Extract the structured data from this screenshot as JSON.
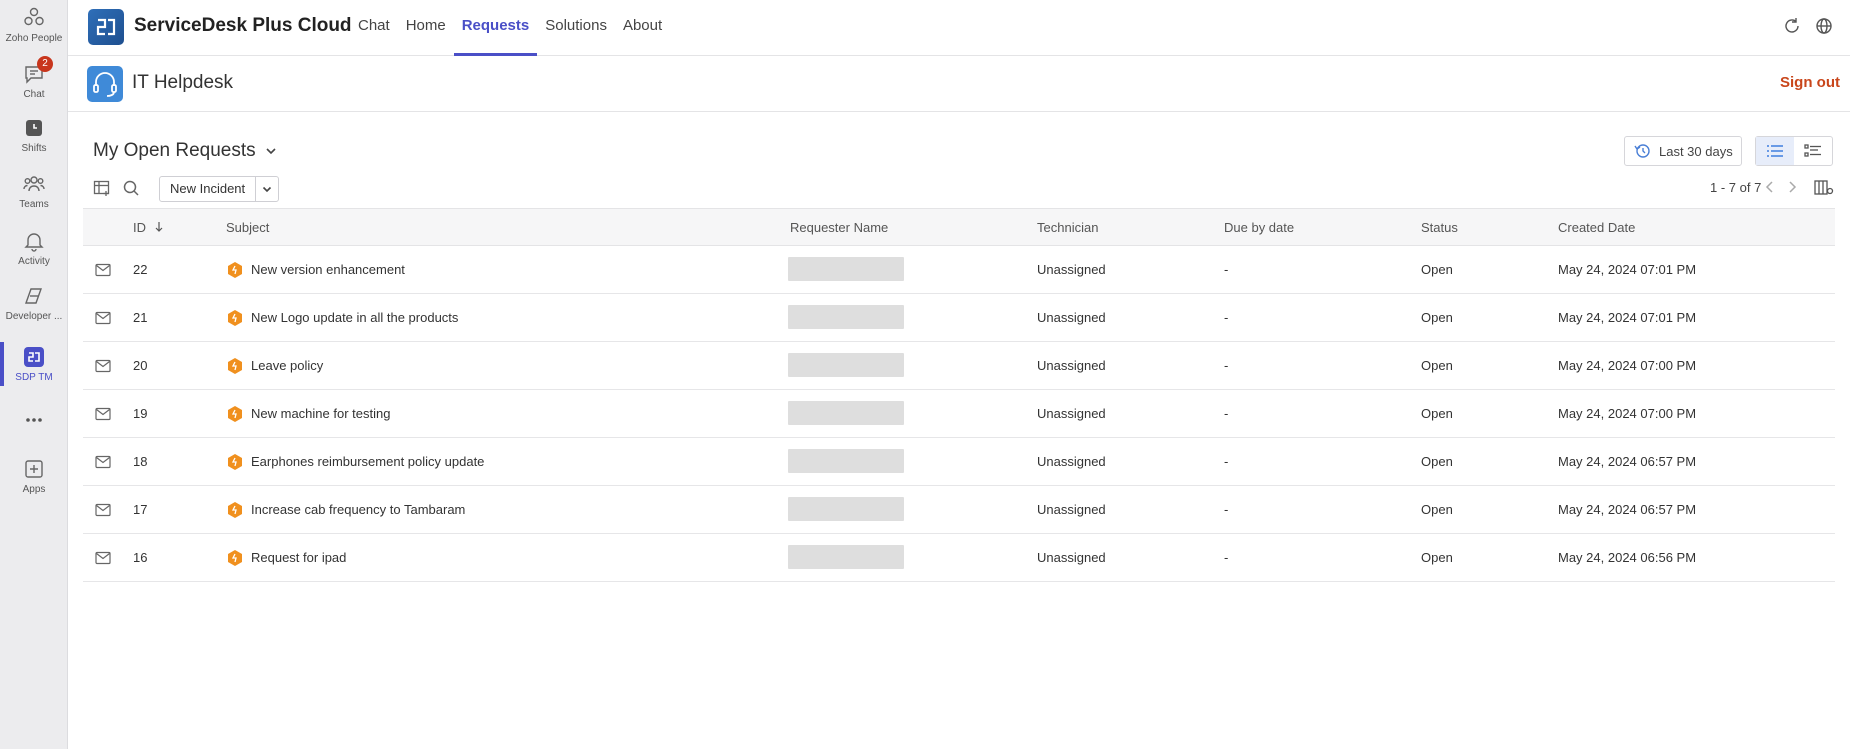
{
  "rail": {
    "items": [
      {
        "label": "Zoho People",
        "icon": "zoho-people-icon"
      },
      {
        "label": "Chat",
        "icon": "chat-icon",
        "badge": "2"
      },
      {
        "label": "Shifts",
        "icon": "shifts-icon"
      },
      {
        "label": "Teams",
        "icon": "teams-icon"
      },
      {
        "label": "Activity",
        "icon": "bell-icon"
      },
      {
        "label": "Developer ...",
        "icon": "developer-icon"
      },
      {
        "label": "SDP TM",
        "icon": "sdp-icon",
        "active": true
      },
      {
        "label": "",
        "icon": "more-icon"
      },
      {
        "label": "Apps",
        "icon": "add-app-icon"
      }
    ]
  },
  "topbar": {
    "title": "ServiceDesk Plus Cloud",
    "tabs": [
      {
        "label": "Chat"
      },
      {
        "label": "Home"
      },
      {
        "label": "Requests",
        "active": true
      },
      {
        "label": "Solutions"
      },
      {
        "label": "About"
      }
    ]
  },
  "subheader": {
    "title": "IT Helpdesk",
    "signout": "Sign out"
  },
  "view": {
    "title": "My Open Requests",
    "range": "Last 30 days",
    "new_incident": "New Incident",
    "pager": "1 - 7 of 7"
  },
  "table": {
    "headers": {
      "id": "ID",
      "subject": "Subject",
      "requester": "Requester Name",
      "technician": "Technician",
      "due": "Due by date",
      "status": "Status",
      "created": "Created Date"
    },
    "rows": [
      {
        "id": "22",
        "subject": "New version enhancement",
        "technician": "Unassigned",
        "due": "-",
        "status": "Open",
        "created": "May 24, 2024 07:01 PM"
      },
      {
        "id": "21",
        "subject": "New Logo update in all the products",
        "technician": "Unassigned",
        "due": "-",
        "status": "Open",
        "created": "May 24, 2024 07:01 PM"
      },
      {
        "id": "20",
        "subject": "Leave policy",
        "technician": "Unassigned",
        "due": "-",
        "status": "Open",
        "created": "May 24, 2024 07:00 PM"
      },
      {
        "id": "19",
        "subject": "New machine for testing",
        "technician": "Unassigned",
        "due": "-",
        "status": "Open",
        "created": "May 24, 2024 07:00 PM"
      },
      {
        "id": "18",
        "subject": "Earphones reimbursement policy update",
        "technician": "Unassigned",
        "due": "-",
        "status": "Open",
        "created": "May 24, 2024 06:57 PM"
      },
      {
        "id": "17",
        "subject": "Increase cab frequency to Tambaram",
        "technician": "Unassigned",
        "due": "-",
        "status": "Open",
        "created": "May 24, 2024 06:57 PM"
      },
      {
        "id": "16",
        "subject": "Request for ipad",
        "technician": "Unassigned",
        "due": "-",
        "status": "Open",
        "created": "May 24, 2024 06:56 PM"
      }
    ]
  },
  "colors": {
    "accent": "#4a4fc7",
    "signout": "#c9461b",
    "badge": "#c8361d",
    "priority": "#f0901e"
  }
}
